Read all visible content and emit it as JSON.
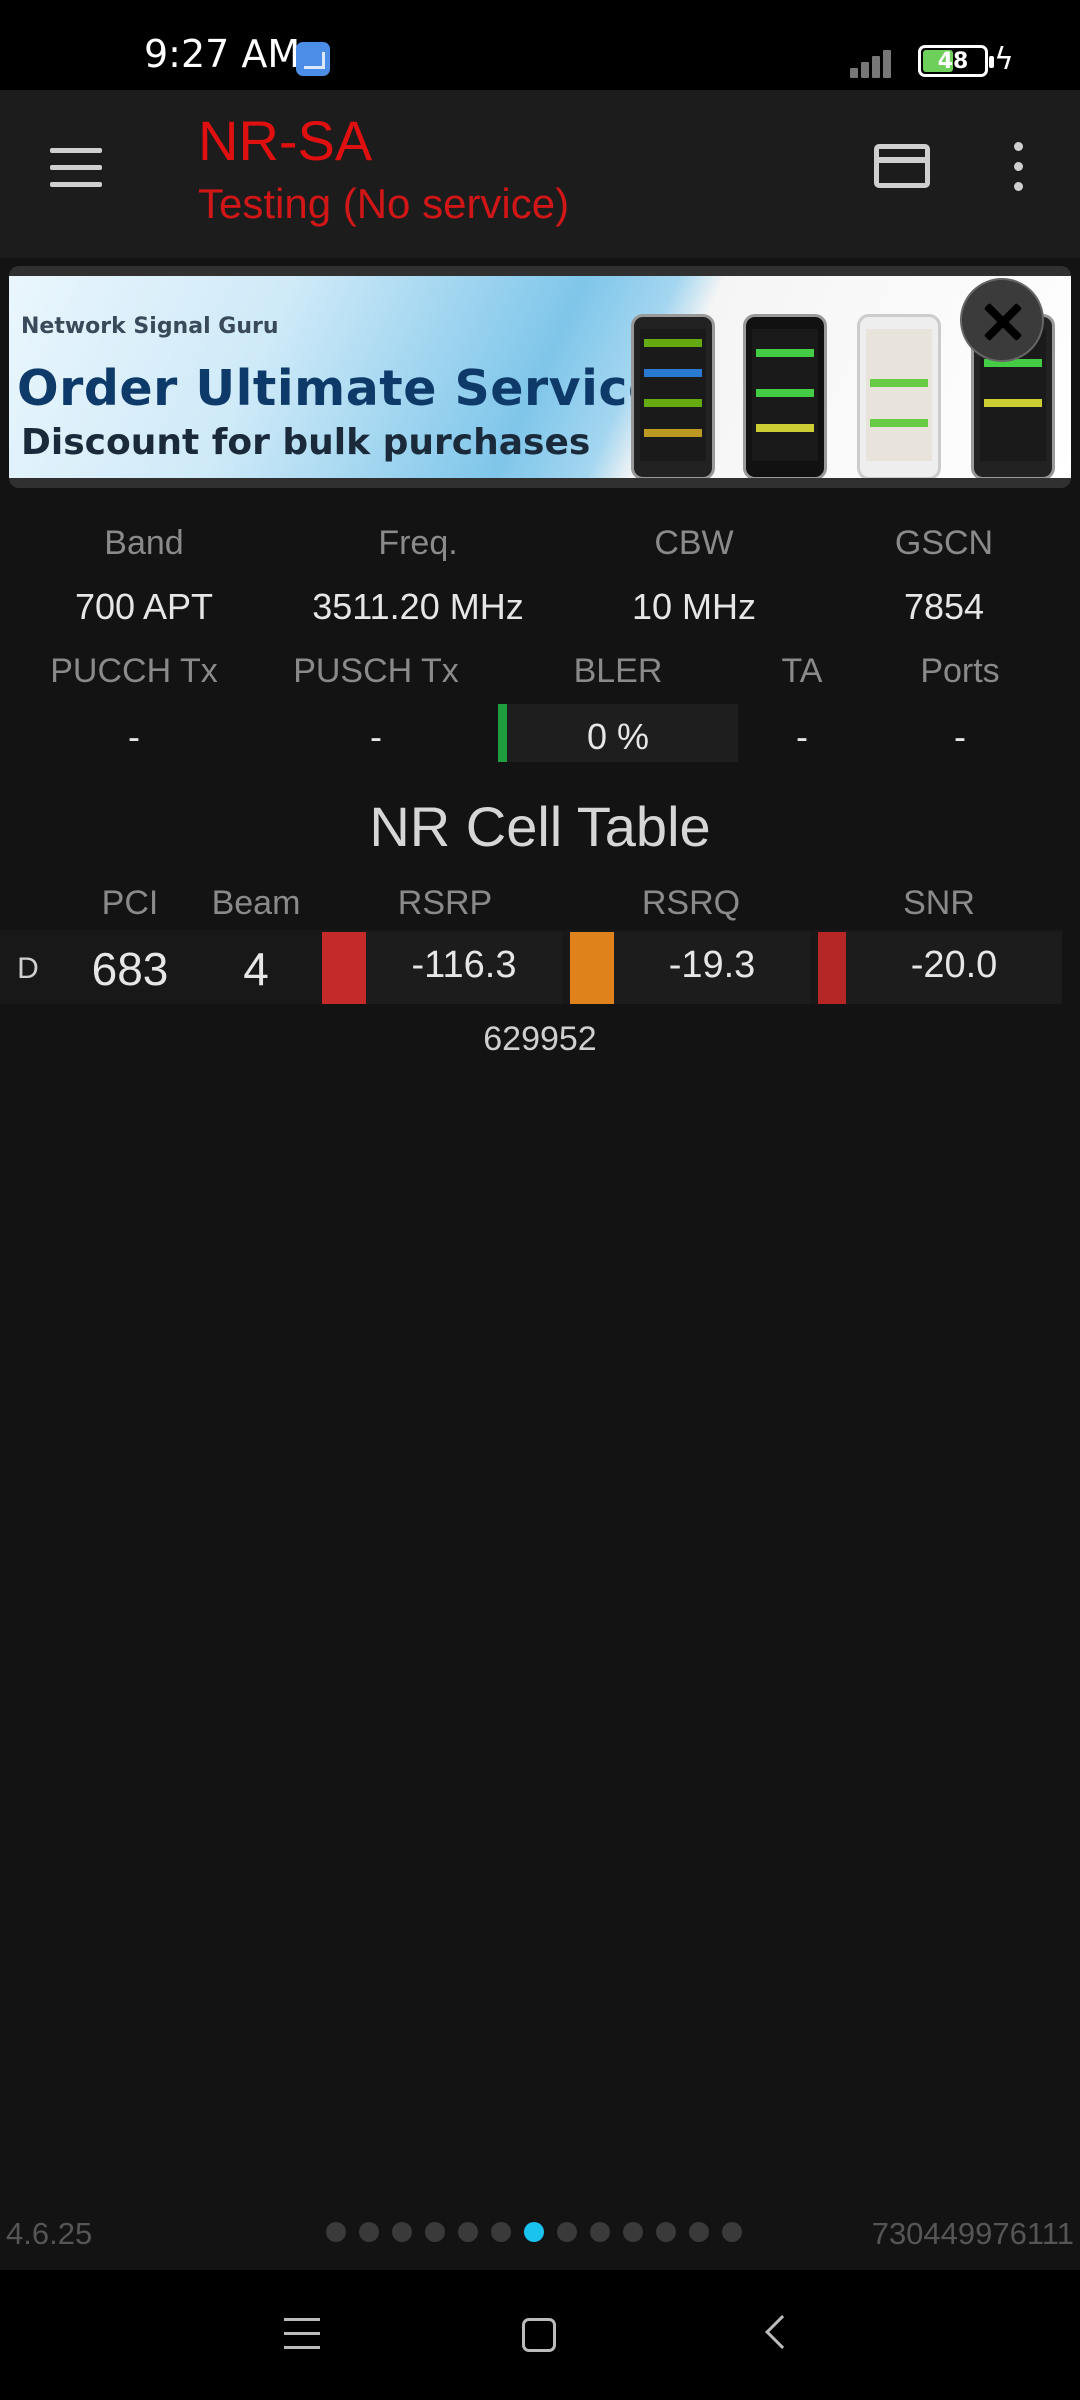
{
  "status_bar": {
    "time": "9:27 AM",
    "battery": "48"
  },
  "app_bar": {
    "title": "NR-SA",
    "subtitle": "Testing (No service)"
  },
  "ad": {
    "brand": "Network Signal Guru",
    "line1": "Order Ultimate Service",
    "line2": "Discount for bulk purchases"
  },
  "info": {
    "labels_row1": [
      "Band",
      "Freq.",
      "CBW",
      "GSCN"
    ],
    "values_row1": [
      "700 APT",
      "3511.20 MHz",
      "10 MHz",
      "7854"
    ],
    "labels_row2": [
      "PUCCH Tx",
      "PUSCH Tx",
      "BLER",
      "TA",
      "Ports"
    ],
    "values_row2": [
      "-",
      "-",
      "0 %",
      "-",
      "-"
    ]
  },
  "cell_table": {
    "title": "NR Cell Table",
    "headers": [
      "PCI",
      "Beam",
      "RSRP",
      "RSRQ",
      "SNR"
    ],
    "row": {
      "type": "D",
      "pci": "683",
      "beam": "4",
      "rsrp": "-116.3",
      "rsrq": "-19.3",
      "snr": "-20.0",
      "id": "629952"
    },
    "colors": {
      "rsrp": "#c42a2a",
      "rsrq": "#e0821c",
      "snr": "#b52626",
      "bler": "#1e9e3e"
    }
  },
  "footer": {
    "version": "4.6.25",
    "page_id": "730449976111",
    "page_count": 13,
    "active_page": 6
  },
  "colors": {
    "accent": "#e01010",
    "active_dot": "#19c3ee"
  }
}
